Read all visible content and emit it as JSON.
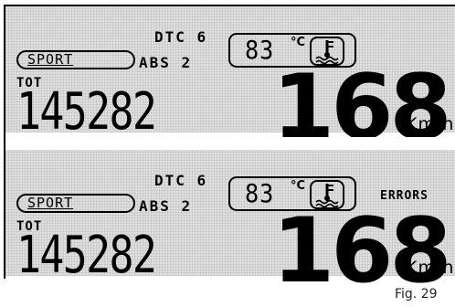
{
  "figure_caption": "Fig. 29",
  "displays": [
    {
      "mode": "SPORT",
      "dtc": "DTC 6",
      "abs": "ABS 2",
      "temperature": "83",
      "temperature_unit": "°C",
      "odometer_label": "TOT",
      "odometer": "145282",
      "speed": "168",
      "speed_unit": "Km/h",
      "coolant_icon": "coolant-temperature-icon"
    },
    {
      "mode": "SPORT",
      "dtc": "DTC 6",
      "abs": "ABS 2",
      "temperature": "83",
      "temperature_unit": "°C",
      "errors": "ERRORS",
      "odometer_label": "TOT",
      "odometer": "145282",
      "speed": "168",
      "speed_unit": "Km/h",
      "coolant_icon": "coolant-temperature-icon"
    }
  ]
}
